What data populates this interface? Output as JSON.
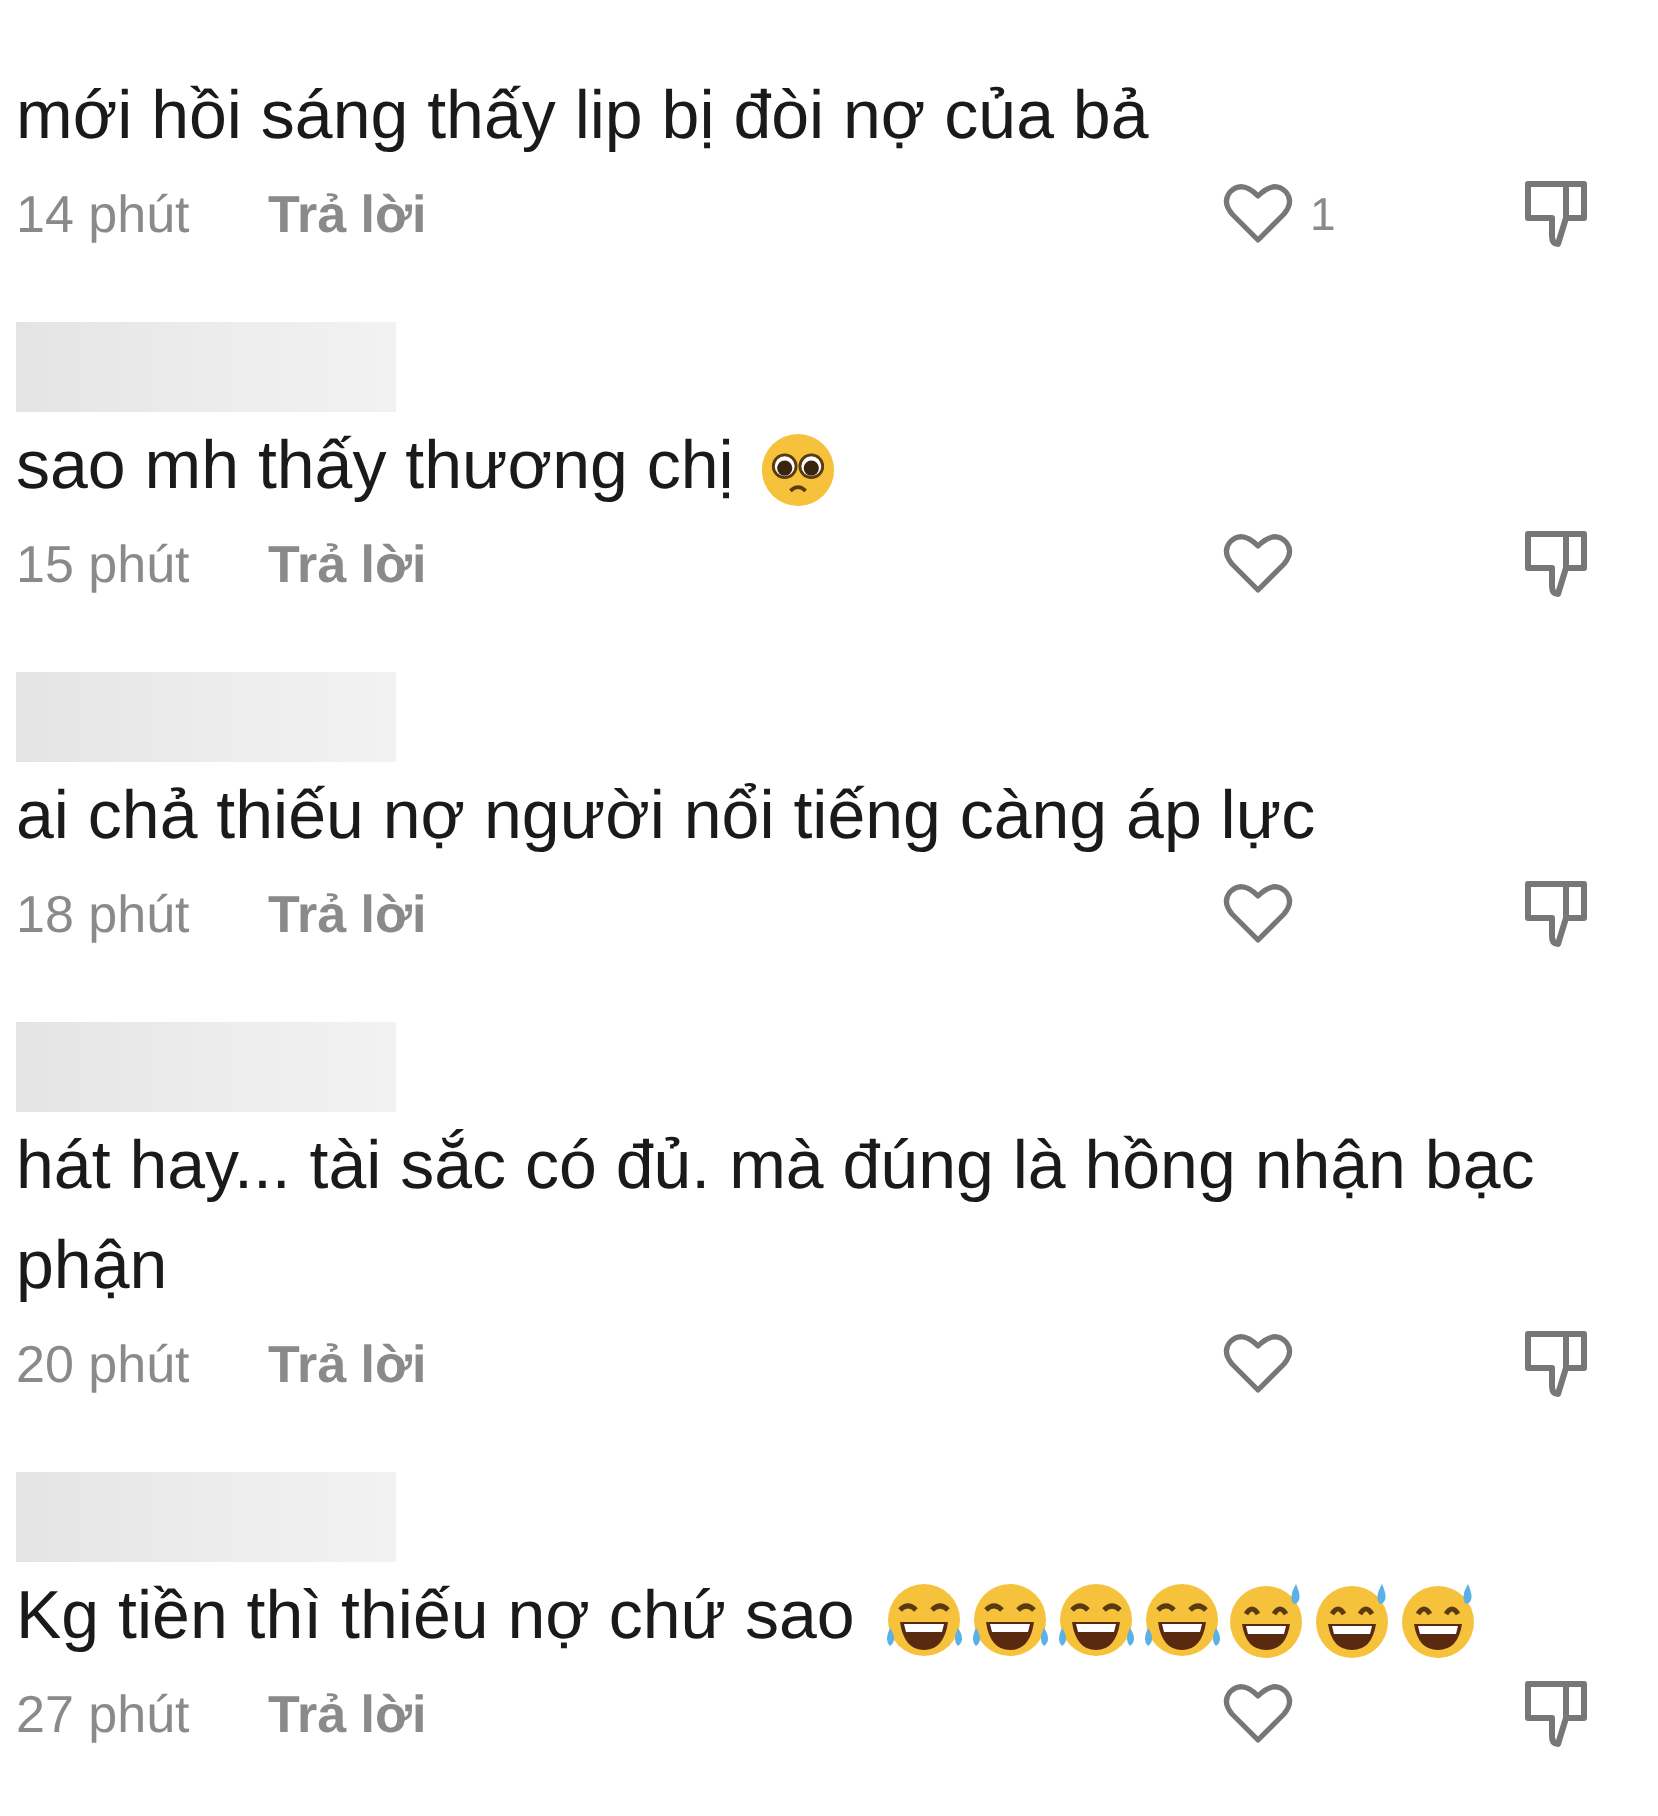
{
  "comments": [
    {
      "text": "mới hồi sáng thấy lip bị đòi nợ của bả",
      "time": "14 phút",
      "reply": "Trả lời",
      "likes": "1"
    },
    {
      "username_hidden": true,
      "text": "sao mh thấy thương chị",
      "emoji_icons": [
        {
          "kind": "pleading"
        }
      ],
      "time": "15 phút",
      "reply": "Trả lời"
    },
    {
      "username_hidden": true,
      "text": "ai chả thiếu nợ người nổi tiếng càng áp lực",
      "time": "18 phút",
      "reply": "Trả lời"
    },
    {
      "username_hidden": true,
      "text": "hát hay... tài sắc có đủ. mà đúng là hồng nhận bạc phận",
      "time": "20 phút",
      "reply": "Trả lời"
    },
    {
      "username_hidden": true,
      "text": "Kg tiền thì thiếu nợ chứ sao",
      "emoji_icons": [
        {
          "kind": "tears_of_joy"
        },
        {
          "kind": "tears_of_joy"
        },
        {
          "kind": "tears_of_joy"
        },
        {
          "kind": "tears_of_joy"
        },
        {
          "kind": "sweat_smile"
        },
        {
          "kind": "sweat_smile"
        },
        {
          "kind": "sweat_smile"
        }
      ],
      "time": "27 phút",
      "reply": "Trả lời"
    }
  ]
}
